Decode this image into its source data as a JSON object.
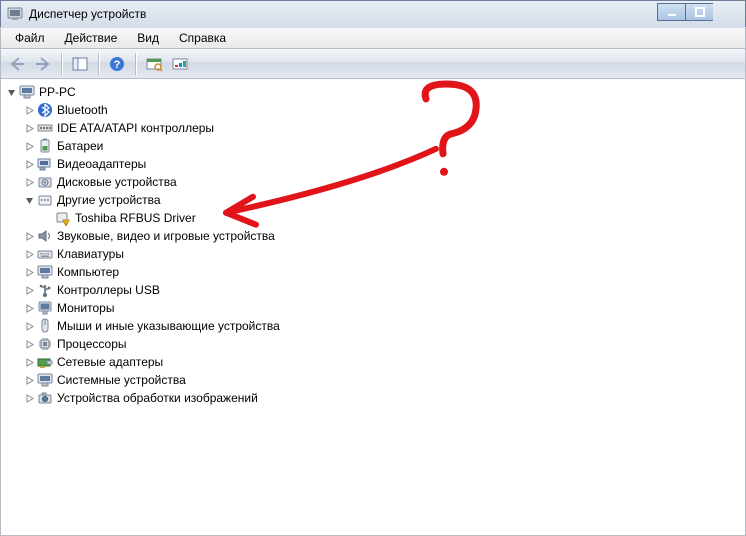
{
  "window": {
    "title": "Диспетчер устройств"
  },
  "menu": {
    "file": "Файл",
    "action": "Действие",
    "view": "Вид",
    "help": "Справка"
  },
  "tree": {
    "root": "PP-PC",
    "bluetooth": "Bluetooth",
    "ide": "IDE ATA/ATAPI контроллеры",
    "batteries": "Батареи",
    "video": "Видеоадаптеры",
    "disk": "Дисковые устройства",
    "other": "Другие устройства",
    "other_child": "Toshiba RFBUS Driver",
    "sound": "Звуковые, видео и игровые устройства",
    "keyboards": "Клавиатуры",
    "computer": "Компьютер",
    "usb": "Контроллеры USB",
    "monitors": "Мониторы",
    "mice": "Мыши и иные указывающие устройства",
    "processors": "Процессоры",
    "network": "Сетевые адаптеры",
    "system": "Системные устройства",
    "imaging": "Устройства обработки изображений"
  }
}
